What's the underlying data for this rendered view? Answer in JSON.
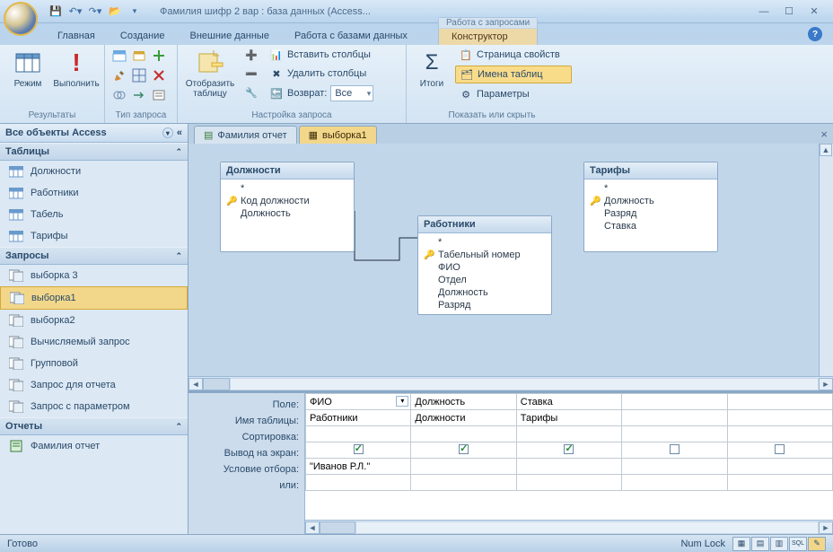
{
  "window": {
    "title": "Фамилия шифр 2 вар : база данных (Access...",
    "context_tab_group": "Работа с запросами",
    "context_tab": "Конструктор"
  },
  "ribbon": {
    "tabs": [
      "Главная",
      "Создание",
      "Внешние данные",
      "Работа с базами данных"
    ],
    "groups": {
      "results": {
        "label": "Результаты",
        "mode": "Режим",
        "run": "Выполнить"
      },
      "query_type": {
        "label": "Тип запроса"
      },
      "setup": {
        "label": "Настройка запроса",
        "show_table": "Отобразить таблицу",
        "insert_cols": "Вставить столбцы",
        "delete_cols": "Удалить столбцы",
        "return": "Возврат:",
        "return_value": "Все"
      },
      "show_hide": {
        "label": "Показать или скрыть",
        "totals": "Итоги",
        "prop_page": "Страница свойств",
        "table_names": "Имена таблиц",
        "parameters": "Параметры"
      }
    }
  },
  "nav": {
    "title": "Все объекты Access",
    "sections": {
      "tables": {
        "label": "Таблицы",
        "items": [
          "Должности",
          "Работники",
          "Табель",
          "Тарифы"
        ]
      },
      "queries": {
        "label": "Запросы",
        "items": [
          "выборка 3",
          "выборка1",
          "выборка2",
          "Вычисляемый запрос",
          "Групповой",
          "Запрос для отчета",
          "Запрос с параметром"
        ],
        "selected": "выборка1"
      },
      "reports": {
        "label": "Отчеты",
        "items": [
          "Фамилия отчет"
        ]
      }
    }
  },
  "workspace": {
    "tabs": [
      {
        "label": "Фамилия отчет",
        "type": "report",
        "active": false
      },
      {
        "label": "выборка1",
        "type": "query",
        "active": true
      }
    ],
    "tables": {
      "t1": {
        "title": "Должности",
        "fields": [
          "*"
        ],
        "key_fields": [
          "Код должности"
        ],
        "plain_fields": [
          "Должность"
        ]
      },
      "t2": {
        "title": "Работники",
        "fields": [
          "*"
        ],
        "key_fields": [
          "Табельный номер"
        ],
        "plain_fields": [
          "ФИО",
          "Отдел",
          "Должность",
          "Разряд"
        ]
      },
      "t3": {
        "title": "Тарифы",
        "fields": [
          "*"
        ],
        "key_fields": [
          "Должность"
        ],
        "plain_fields": [
          "Разряд",
          "Ставка"
        ]
      }
    },
    "grid": {
      "row_labels": [
        "Поле:",
        "Имя таблицы:",
        "Сортировка:",
        "Вывод на экран:",
        "Условие отбора:",
        "или:"
      ],
      "columns": [
        {
          "field": "ФИО",
          "table": "Работники",
          "sort": "",
          "show": true,
          "criteria": "\"Иванов Р.Л.\"",
          "or": ""
        },
        {
          "field": "Должность",
          "table": "Должности",
          "sort": "",
          "show": true,
          "criteria": "",
          "or": ""
        },
        {
          "field": "Ставка",
          "table": "Тарифы",
          "sort": "",
          "show": true,
          "criteria": "",
          "or": ""
        },
        {
          "field": "",
          "table": "",
          "sort": "",
          "show": false,
          "criteria": "",
          "or": ""
        },
        {
          "field": "",
          "table": "",
          "sort": "",
          "show": false,
          "criteria": "",
          "or": ""
        }
      ]
    }
  },
  "statusbar": {
    "ready": "Готово",
    "numlock": "Num Lock"
  }
}
